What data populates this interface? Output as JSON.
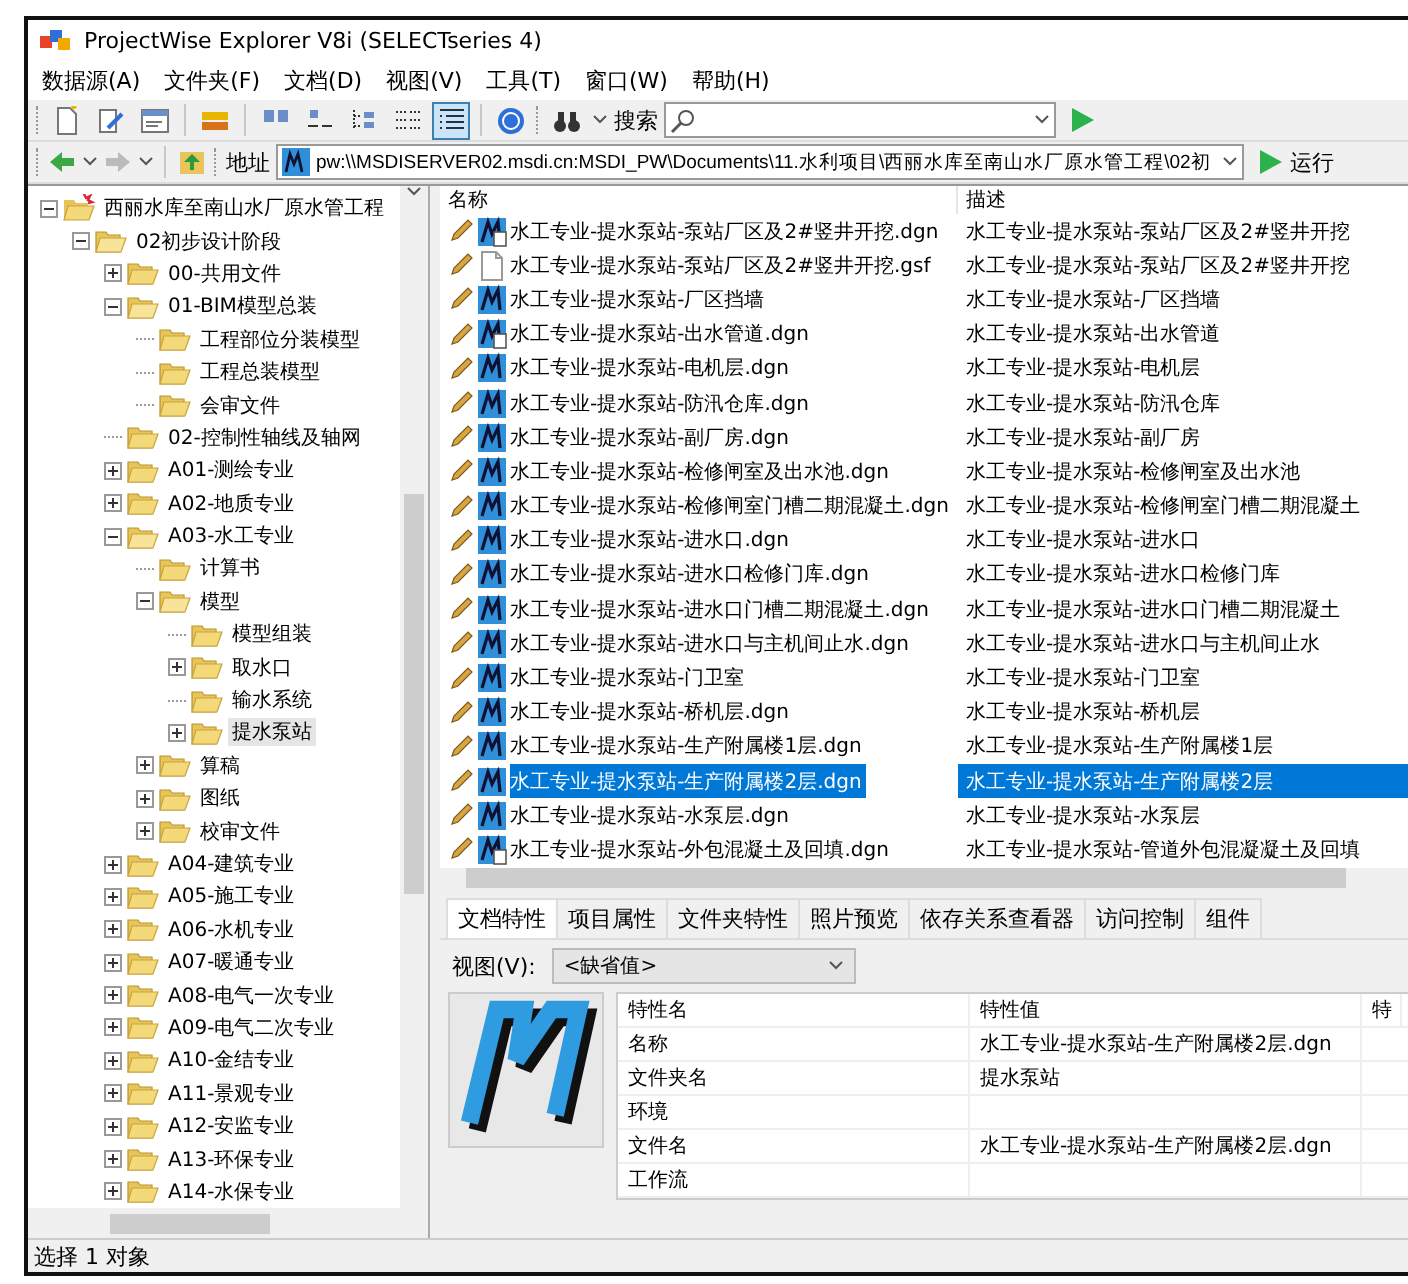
{
  "window": {
    "title": "ProjectWise Explorer V8i (SELECTseries 4)"
  },
  "menu": [
    "数据源(A)",
    "文件夹(F)",
    "文档(D)",
    "视图(V)",
    "工具(T)",
    "窗口(W)",
    "帮助(H)"
  ],
  "view_buttons": [
    {
      "kind": "large-icons",
      "selected": false
    },
    {
      "kind": "small-icons",
      "selected": false
    },
    {
      "kind": "tree",
      "selected": false
    },
    {
      "kind": "list",
      "selected": false
    },
    {
      "kind": "details",
      "selected": true
    }
  ],
  "search": {
    "label": "搜索"
  },
  "address": {
    "label": "地址",
    "value": "pw:\\\\MSDISERVER02.msdi.cn:MSDI_PW\\Documents\\11.水利项目\\西丽水库至南山水厂原水管工程\\02初",
    "run": "运行"
  },
  "tree": [
    {
      "label": "西丽水库至南山水厂原水管工程",
      "kind": "project",
      "expanded": true,
      "selected": false,
      "children": [
        {
          "label": "02初步设计阶段",
          "kind": "branch",
          "expanded": true,
          "selected": false,
          "children": [
            {
              "label": "00-共用文件",
              "kind": "branch",
              "expanded": false,
              "selected": false
            },
            {
              "label": "01-BIM模型总装",
              "kind": "branch",
              "expanded": true,
              "selected": false,
              "children": [
                {
                  "label": "工程部位分装模型",
                  "kind": "leaf",
                  "selected": false
                },
                {
                  "label": "工程总装模型",
                  "kind": "leaf",
                  "selected": false
                },
                {
                  "label": "会审文件",
                  "kind": "leaf",
                  "selected": false
                }
              ]
            },
            {
              "label": "02-控制性轴线及轴网",
              "kind": "leaf",
              "selected": false
            },
            {
              "label": "A01-测绘专业",
              "kind": "branch",
              "expanded": false,
              "selected": false
            },
            {
              "label": "A02-地质专业",
              "kind": "branch",
              "expanded": false,
              "selected": false
            },
            {
              "label": "A03-水工专业",
              "kind": "branch",
              "expanded": true,
              "selected": false,
              "children": [
                {
                  "label": "计算书",
                  "kind": "leaf",
                  "selected": false
                },
                {
                  "label": "模型",
                  "kind": "branch",
                  "expanded": true,
                  "selected": false,
                  "children": [
                    {
                      "label": "模型组装",
                      "kind": "leaf",
                      "selected": false
                    },
                    {
                      "label": "取水口",
                      "kind": "branch",
                      "expanded": false,
                      "selected": false
                    },
                    {
                      "label": "输水系统",
                      "kind": "leaf",
                      "selected": false
                    },
                    {
                      "label": "提水泵站",
                      "kind": "branch",
                      "expanded": false,
                      "selected": true
                    }
                  ]
                },
                {
                  "label": "算稿",
                  "kind": "branch",
                  "expanded": false,
                  "selected": false
                },
                {
                  "label": "图纸",
                  "kind": "branch",
                  "expanded": false,
                  "selected": false
                },
                {
                  "label": "校审文件",
                  "kind": "branch",
                  "expanded": false,
                  "selected": false
                }
              ]
            },
            {
              "label": "A04-建筑专业",
              "kind": "branch",
              "expanded": false,
              "selected": false
            },
            {
              "label": "A05-施工专业",
              "kind": "branch",
              "expanded": false,
              "selected": false
            },
            {
              "label": "A06-水机专业",
              "kind": "branch",
              "expanded": false,
              "selected": false
            },
            {
              "label": "A07-暖通专业",
              "kind": "branch",
              "expanded": false,
              "selected": false
            },
            {
              "label": "A08-电气一次专业",
              "kind": "branch",
              "expanded": false,
              "selected": false
            },
            {
              "label": "A09-电气二次专业",
              "kind": "branch",
              "expanded": false,
              "selected": false
            },
            {
              "label": "A10-金结专业",
              "kind": "branch",
              "expanded": false,
              "selected": false
            },
            {
              "label": "A11-景观专业",
              "kind": "branch",
              "expanded": false,
              "selected": false
            },
            {
              "label": "A12-安监专业",
              "kind": "branch",
              "expanded": false,
              "selected": false
            },
            {
              "label": "A13-环保专业",
              "kind": "branch",
              "expanded": false,
              "selected": false
            },
            {
              "label": "A14-水保专业",
              "kind": "branch",
              "expanded": false,
              "selected": false
            }
          ]
        }
      ]
    }
  ],
  "file_list": {
    "columns": [
      "名称",
      "描述"
    ],
    "rows": [
      {
        "name": "水工专业-提水泵站-泵站厂区及2#竖井开挖.dgn",
        "description": "水工专业-提水泵站-泵站厂区及2#竖井开挖",
        "kind": "dgn-ref",
        "selected": false
      },
      {
        "name": "水工专业-提水泵站-泵站厂区及2#竖井开挖.gsf",
        "description": "水工专业-提水泵站-泵站厂区及2#竖井开挖",
        "kind": "document",
        "selected": false
      },
      {
        "name": "水工专业-提水泵站-厂区挡墙",
        "description": "水工专业-提水泵站-厂区挡墙",
        "kind": "dgn",
        "selected": false
      },
      {
        "name": "水工专业-提水泵站-出水管道.dgn",
        "description": "水工专业-提水泵站-出水管道",
        "kind": "dgn-ref",
        "selected": false
      },
      {
        "name": "水工专业-提水泵站-电机层.dgn",
        "description": "水工专业-提水泵站-电机层",
        "kind": "dgn",
        "selected": false
      },
      {
        "name": "水工专业-提水泵站-防汛仓库.dgn",
        "description": "水工专业-提水泵站-防汛仓库",
        "kind": "dgn",
        "selected": false
      },
      {
        "name": "水工专业-提水泵站-副厂房.dgn",
        "description": "水工专业-提水泵站-副厂房",
        "kind": "dgn",
        "selected": false
      },
      {
        "name": "水工专业-提水泵站-检修闸室及出水池.dgn",
        "description": "水工专业-提水泵站-检修闸室及出水池",
        "kind": "dgn",
        "selected": false
      },
      {
        "name": "水工专业-提水泵站-检修闸室门槽二期混凝土.dgn",
        "description": "水工专业-提水泵站-检修闸室门槽二期混凝土",
        "kind": "dgn",
        "selected": false
      },
      {
        "name": "水工专业-提水泵站-进水口.dgn",
        "description": "水工专业-提水泵站-进水口",
        "kind": "dgn",
        "selected": false
      },
      {
        "name": "水工专业-提水泵站-进水口检修门库.dgn",
        "description": "水工专业-提水泵站-进水口检修门库",
        "kind": "dgn",
        "selected": false
      },
      {
        "name": "水工专业-提水泵站-进水口门槽二期混凝土.dgn",
        "description": "水工专业-提水泵站-进水口门槽二期混凝土",
        "kind": "dgn",
        "selected": false
      },
      {
        "name": "水工专业-提水泵站-进水口与主机间止水.dgn",
        "description": "水工专业-提水泵站-进水口与主机间止水",
        "kind": "dgn",
        "selected": false
      },
      {
        "name": "水工专业-提水泵站-门卫室",
        "description": "水工专业-提水泵站-门卫室",
        "kind": "dgn",
        "selected": false
      },
      {
        "name": "水工专业-提水泵站-桥机层.dgn",
        "description": "水工专业-提水泵站-桥机层",
        "kind": "dgn",
        "selected": false
      },
      {
        "name": "水工专业-提水泵站-生产附属楼1层.dgn",
        "description": "水工专业-提水泵站-生产附属楼1层",
        "kind": "dgn",
        "selected": false
      },
      {
        "name": "水工专业-提水泵站-生产附属楼2层.dgn",
        "description": "水工专业-提水泵站-生产附属楼2层",
        "kind": "dgn",
        "selected": true
      },
      {
        "name": "水工专业-提水泵站-水泵层.dgn",
        "description": "水工专业-提水泵站-水泵层",
        "kind": "dgn",
        "selected": false
      },
      {
        "name": "水工专业-提水泵站-外包混凝土及回填.dgn",
        "description": "水工专业-提水泵站-管道外包混凝凝土及回填",
        "kind": "dgn-ref",
        "selected": false
      }
    ]
  },
  "details": {
    "tabs": [
      {
        "label": "文档特性",
        "selected": true
      },
      {
        "label": "项目属性",
        "selected": false
      },
      {
        "label": "文件夹特性",
        "selected": false
      },
      {
        "label": "照片预览",
        "selected": false
      },
      {
        "label": "依存关系查看器",
        "selected": false
      },
      {
        "label": "访问控制",
        "selected": false
      },
      {
        "label": "组件",
        "selected": false
      }
    ],
    "view_label": "视图(V):",
    "view_value": "<缺省值>",
    "table": {
      "columns": [
        "特性名",
        "特性值",
        "特"
      ],
      "rows": [
        {
          "name": "名称",
          "value": "水工专业-提水泵站-生产附属楼2层.dgn"
        },
        {
          "name": "文件夹名",
          "value": "提水泵站"
        },
        {
          "name": "环境"
        },
        {
          "name": "文件名",
          "value": "水工专业-提水泵站-生产附属楼2层.dgn"
        },
        {
          "name": "工作流"
        }
      ]
    }
  },
  "status_bar": "选择 1 对象"
}
